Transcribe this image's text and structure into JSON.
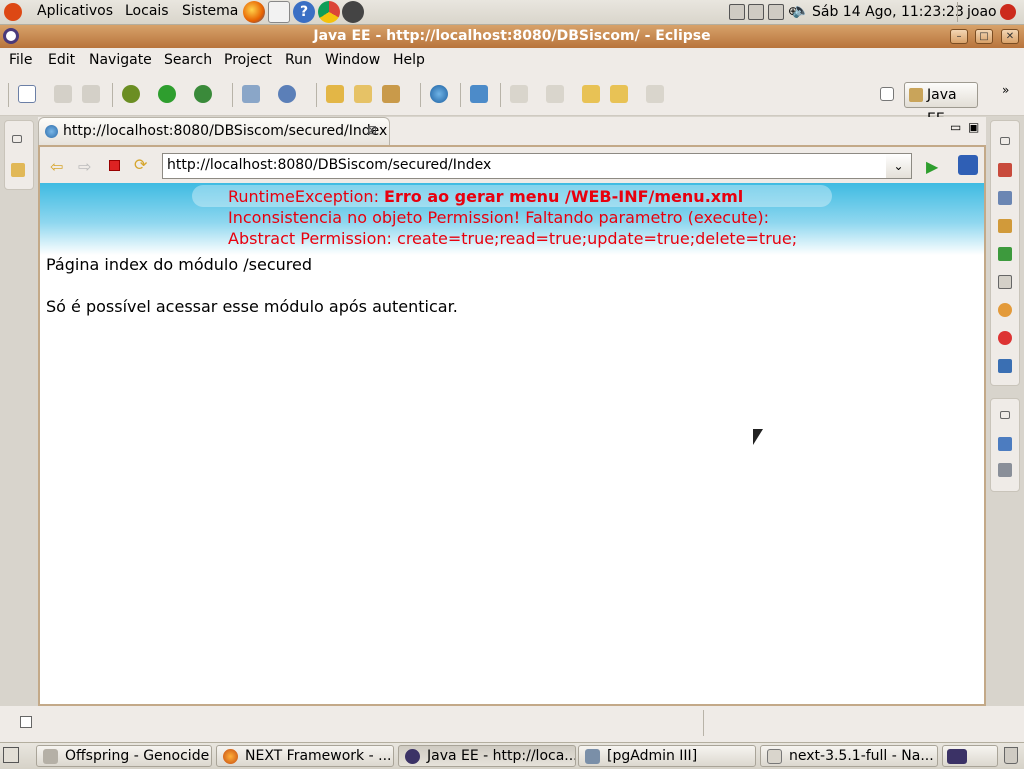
{
  "gnome_panel": {
    "menus": [
      "Aplicativos",
      "Locais",
      "Sistema"
    ],
    "clock": "Sáb 14 Ago, 11:23:23",
    "user": "joao"
  },
  "window": {
    "title": "Java EE - http://localhost:8080/DBSiscom/ - Eclipse"
  },
  "menubar": [
    "File",
    "Edit",
    "Navigate",
    "Search",
    "Project",
    "Run",
    "Window",
    "Help"
  ],
  "perspective": {
    "label": "Java EE"
  },
  "editor": {
    "tab_title": "http://localhost:8080/DBSiscom/secured/Index",
    "url": "http://localhost:8080/DBSiscom/secured/Index"
  },
  "page": {
    "error_prefix": "RuntimeException: ",
    "error_bold": "Erro ao gerar menu /WEB-INF/menu.xml",
    "error_line2": "Inconsistencia no objeto Permission! Faltando parametro (execute):",
    "error_line3": "Abstract Permission: create=true;read=true;update=true;delete=true;",
    "heading": "Página index do módulo /secured",
    "message": "Só é possível acessar esse módulo após autenticar."
  },
  "taskbar": [
    "Offspring - Genocide",
    "NEXT Framework - ...",
    "Java EE - http://loca...",
    "[pgAdmin III]",
    "next-3.5.1-full - Na..."
  ],
  "colors": {
    "error": "#e8000e",
    "titlebar": "#c8874d",
    "banner": "#3fbbe2"
  }
}
